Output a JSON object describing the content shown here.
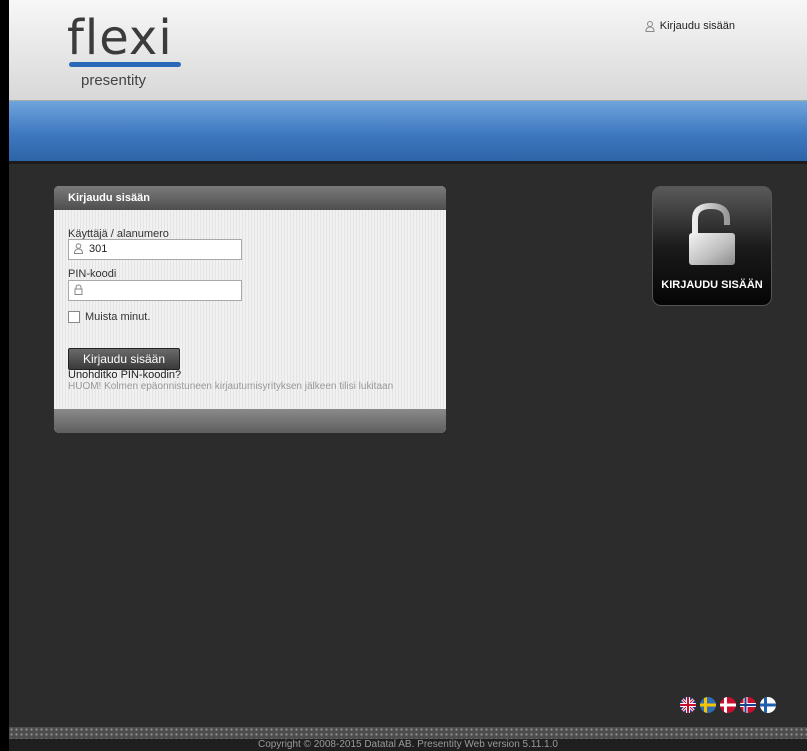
{
  "logo": {
    "main": "flexi",
    "sub": "presentity"
  },
  "header": {
    "login_link": "Kirjaudu sisään"
  },
  "login_panel": {
    "title": "Kirjaudu sisään",
    "user_label": "Käyttäjä / alanumero",
    "user_value": "301",
    "pin_label": "PIN-koodi",
    "pin_value": "",
    "remember_label": "Muista minut.",
    "submit_label": "Kirjaudu sisään",
    "forgot_link": "Unohditko PIN-koodin?",
    "warning": "HUOM! Kolmen epäonnistuneen kirjautumisyrityksen jälkeen tilisi lukitaan"
  },
  "big_login": {
    "label": "KIRJAUDU SISÄÄN",
    "icon": "padlock-icon"
  },
  "languages": [
    {
      "name": "flag-uk-icon"
    },
    {
      "name": "flag-sweden-icon"
    },
    {
      "name": "flag-denmark-icon"
    },
    {
      "name": "flag-norway-icon"
    },
    {
      "name": "flag-finland-icon"
    }
  ],
  "footer": {
    "copyright": "Copyright © 2008-2015 Datatal AB. Presentity Web version 5.11.1.0"
  },
  "colors": {
    "background": "#2c2c2c",
    "accent_blue": "#3e78bf",
    "panel_header": "#5e5e5e"
  }
}
